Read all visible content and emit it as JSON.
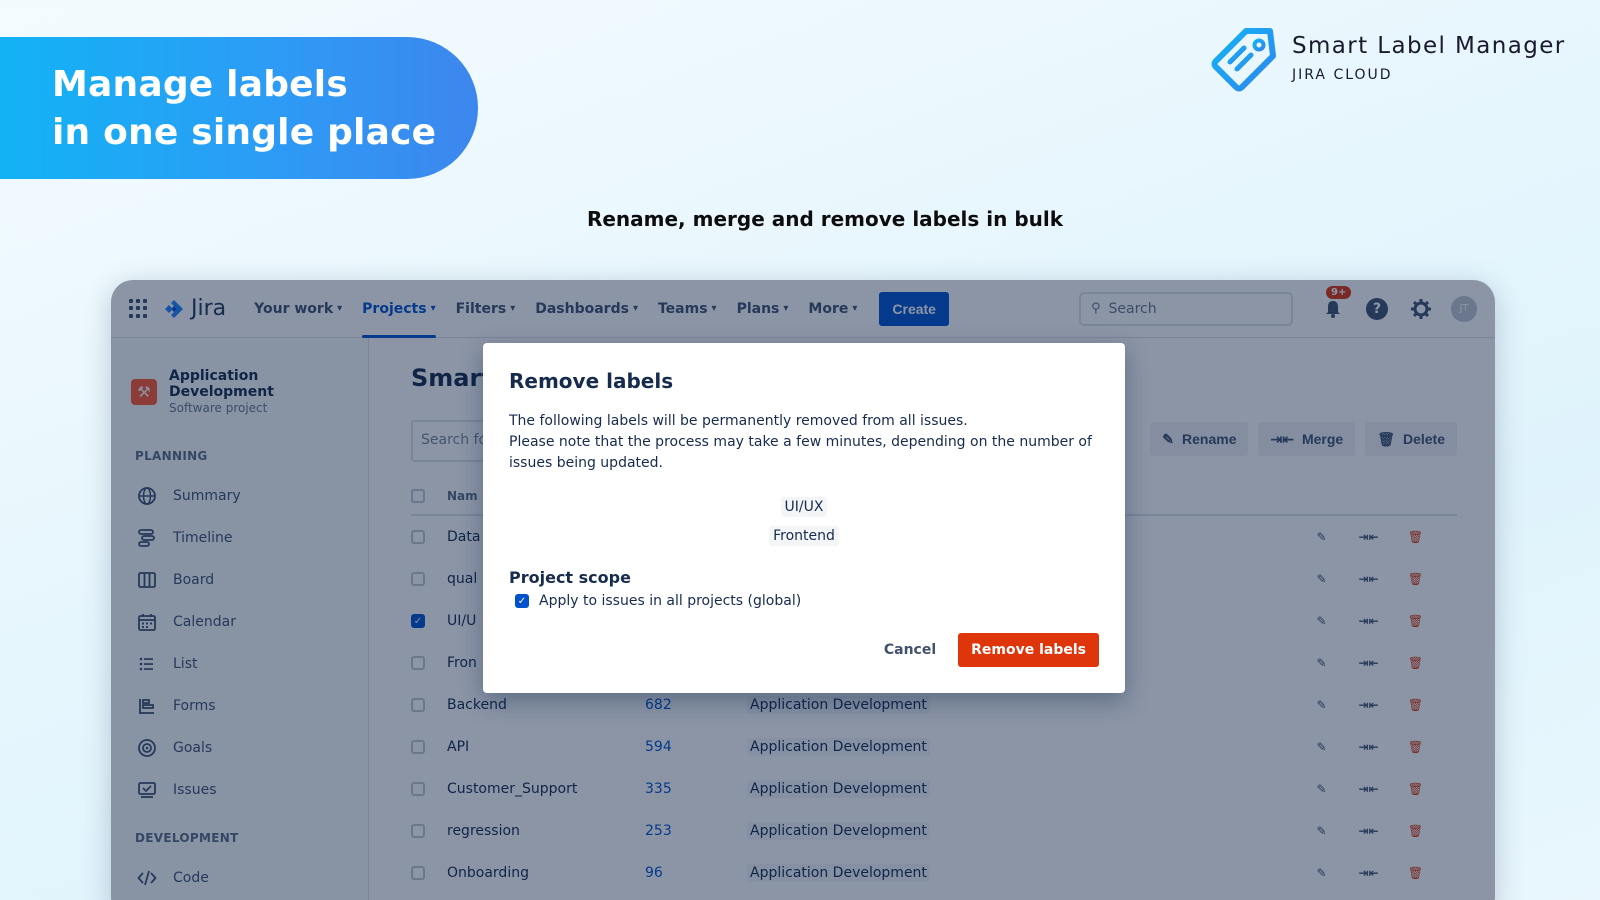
{
  "hero": {
    "line1": "Manage labels",
    "line2": "in one single place"
  },
  "brand": {
    "name": "Smart Label Manager",
    "sub": "JIRA CLOUD"
  },
  "tagline": "Rename, merge and remove labels in bulk",
  "jira": {
    "logo_text": "Jira",
    "nav": [
      {
        "label": "Your work"
      },
      {
        "label": "Projects"
      },
      {
        "label": "Filters"
      },
      {
        "label": "Dashboards"
      },
      {
        "label": "Teams"
      },
      {
        "label": "Plans"
      },
      {
        "label": "More"
      }
    ],
    "create_label": "Create",
    "search_placeholder": "Search",
    "notif_badge": "9+",
    "avatar_initials": "JT"
  },
  "sidebar": {
    "project_name": "Application Development",
    "project_type": "Software project",
    "planning_title": "PLANNING",
    "planning_items": [
      "Summary",
      "Timeline",
      "Board",
      "Calendar",
      "List",
      "Forms",
      "Goals",
      "Issues"
    ],
    "development_title": "DEVELOPMENT",
    "development_items": [
      "Code"
    ]
  },
  "main": {
    "title": "Smart",
    "search_placeholder": "Search fo",
    "actions": {
      "rename": "Rename",
      "merge": "Merge",
      "delete": "Delete"
    },
    "col_name": "Nam",
    "rows": [
      {
        "name": "Data",
        "count": "",
        "project": ""
      },
      {
        "name": "qual",
        "count": "",
        "project": ""
      },
      {
        "name": "UI/U",
        "count": "",
        "project": ""
      },
      {
        "name": "Fron",
        "count": "",
        "project": ""
      },
      {
        "name": "Backend",
        "count": "682",
        "project": "Application Development"
      },
      {
        "name": "API",
        "count": "594",
        "project": "Application Development"
      },
      {
        "name": "Customer_Support",
        "count": "335",
        "project": "Application Development"
      },
      {
        "name": "regression",
        "count": "253",
        "project": "Application Development"
      },
      {
        "name": "Onboarding",
        "count": "96",
        "project": "Application Development"
      }
    ]
  },
  "modal": {
    "title": "Remove labels",
    "msg1": "The following labels will be permanently removed from all issues.",
    "msg2": "Please note that the process may take a few minutes, depending on the number of issues being updated.",
    "labels": [
      "UI/UX",
      "Frontend"
    ],
    "scope_title": "Project scope",
    "scope_option": "Apply to issues in all projects (global)",
    "cancel": "Cancel",
    "confirm": "Remove labels"
  }
}
